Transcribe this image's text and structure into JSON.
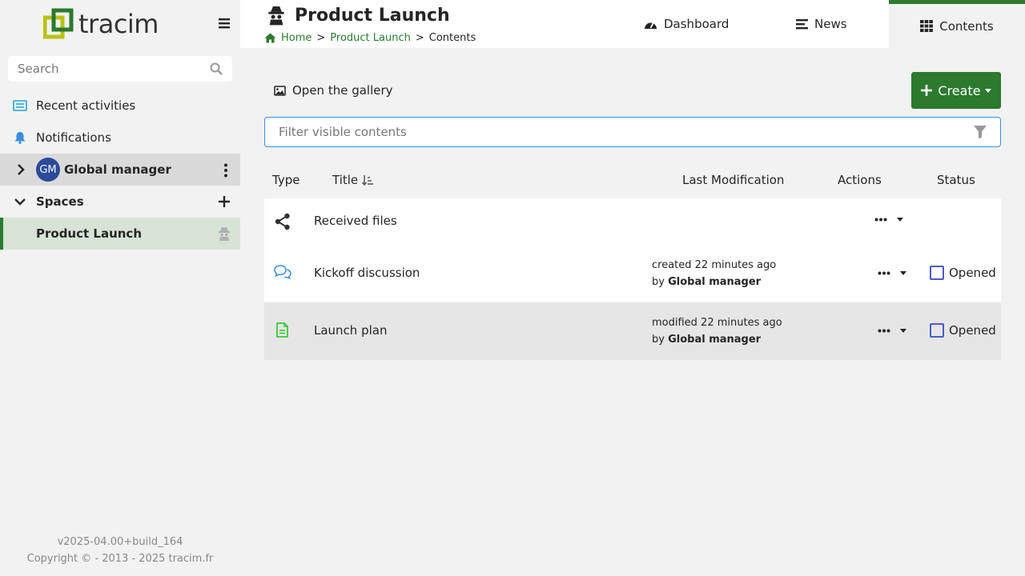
{
  "app": {
    "logo_text": "tracim"
  },
  "search": {
    "placeholder": "Search"
  },
  "sidebar": {
    "recent": "Recent activities",
    "notifications": "Notifications",
    "user": {
      "initials": "GM",
      "name": "Global manager"
    },
    "spaces_label": "Spaces",
    "space_item": "Product Launch"
  },
  "footer": {
    "version": "v2025-04.00+build_164",
    "copyright": "Copyright © - 2013 - 2025 tracim.fr"
  },
  "header": {
    "title": "Product Launch",
    "breadcrumb": {
      "home": "Home",
      "sep1": ">",
      "space": "Product Launch",
      "sep2": ">",
      "current": "Contents"
    },
    "tabs": {
      "dashboard": "Dashboard",
      "news": "News",
      "contents": "Contents"
    }
  },
  "toolbar": {
    "gallery": "Open the gallery",
    "create": "Create"
  },
  "filter": {
    "placeholder": "Filter visible contents"
  },
  "table": {
    "headers": {
      "type": "Type",
      "title": "Title",
      "modified": "Last Modification",
      "actions": "Actions",
      "status": "Status"
    },
    "rows": [
      {
        "title": "Received files",
        "type_icon": "share-icon"
      },
      {
        "title": "Kickoff discussion",
        "type_icon": "discussion-icon",
        "mod_line": "created 22 minutes ago",
        "by": "by",
        "author": "Global manager",
        "status": "Opened"
      },
      {
        "title": "Launch plan",
        "type_icon": "document-icon",
        "mod_line": "modified 22 minutes ago",
        "by": "by",
        "author": "Global manager",
        "status": "Opened"
      }
    ]
  },
  "colors": {
    "accent": "#2b7a2e",
    "filter_border": "#3a8dde",
    "avatar": "#2a4a9a"
  }
}
